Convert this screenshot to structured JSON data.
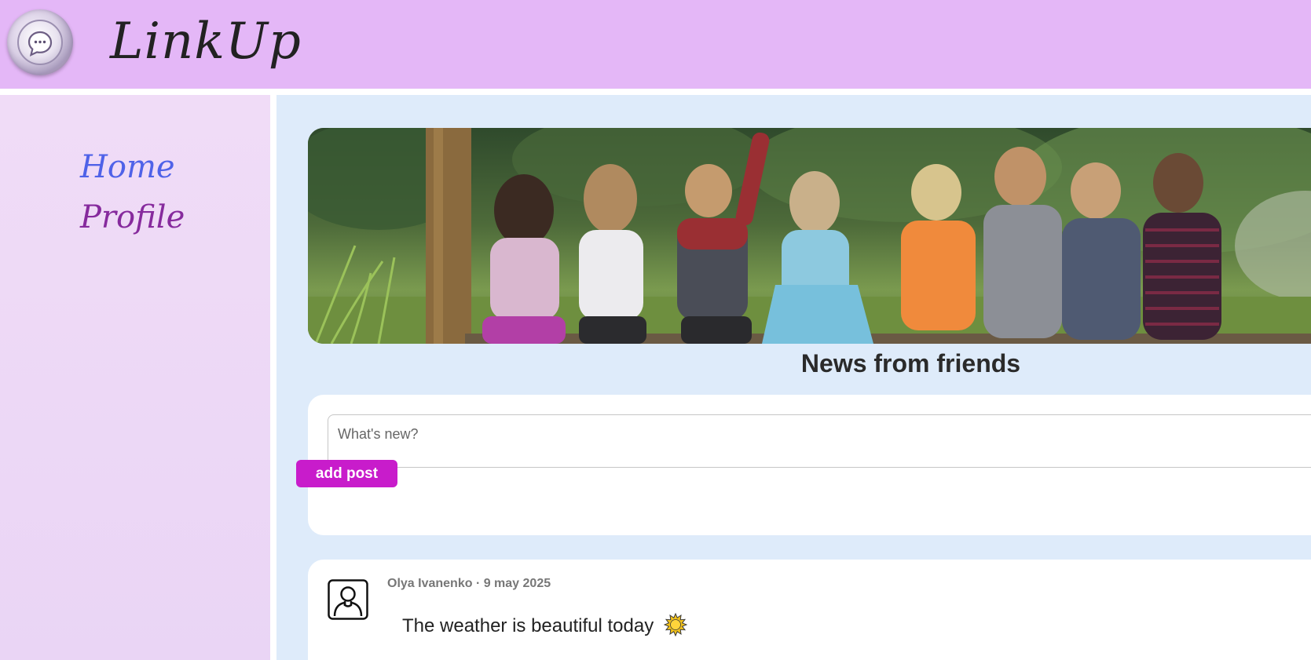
{
  "app": {
    "title": "LinkUp"
  },
  "sidebar": {
    "items": [
      {
        "label": "Home",
        "color": "#4f62e8"
      },
      {
        "label": "Profile",
        "color": "#862a9d"
      }
    ]
  },
  "main": {
    "title": "News from friends",
    "banner": {
      "icon": "children-photo"
    }
  },
  "composer": {
    "placeholder": "What's new?",
    "button_label": "add post",
    "button_color": "#c81ccb"
  },
  "posts": [
    {
      "author": "Olya Ivanenko",
      "date": "9 may 2025",
      "meta": "Olya Ivanenko · 9 may 2025",
      "text": "The weather is beautiful today",
      "icon": "sun-icon"
    }
  ],
  "colors": {
    "header_bg": "#e4b7f7",
    "sidebar_bg": "#efdaf6",
    "main_bg": "#deebfa"
  }
}
